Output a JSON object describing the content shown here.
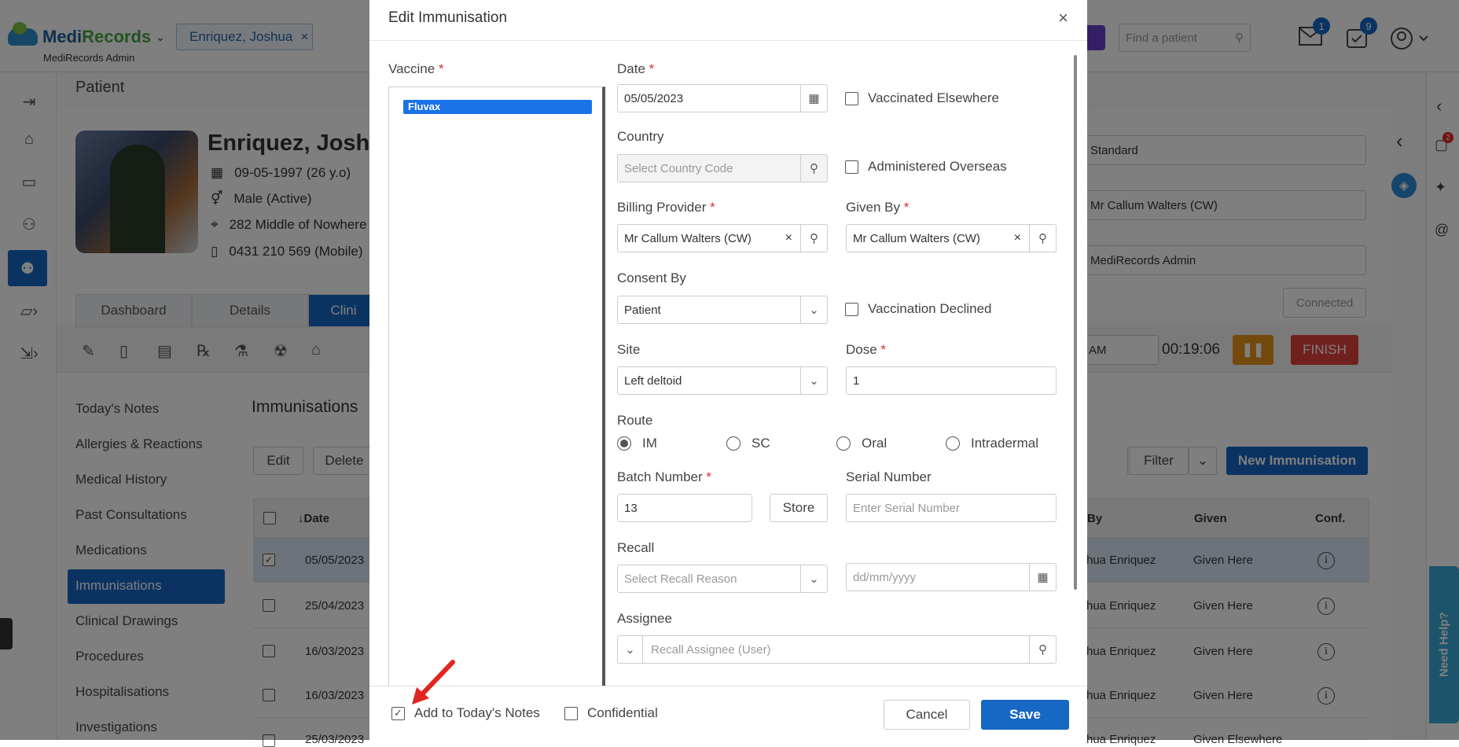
{
  "app": {
    "brand_main": "Medi",
    "brand_accent": "Records",
    "sub": "MediRecords Admin",
    "patient_chip": "Enriquez, Joshua",
    "find_placeholder": "Find a patient",
    "mail_count": "1",
    "tasks_count": "9"
  },
  "page": {
    "title": "Patient"
  },
  "patient": {
    "name": "Enriquez, Joshua",
    "dob": "09-05-1997 (26 y.o)",
    "gender": "Male (Active)",
    "address": "282 Middle of Nowhere",
    "phone": "0431 210 569 (Mobile)"
  },
  "tabs": [
    "Dashboard",
    "Details",
    "Clini"
  ],
  "right_panel": {
    "template": "Standard",
    "doctor": "Mr Callum Walters (CW)",
    "org": "MediRecords Admin",
    "connected": "Connected",
    "am": "AM",
    "timer": "00:19:06",
    "finish": "FINISH",
    "chat_badge": "2"
  },
  "clinical_nav": [
    "Today's Notes",
    "Allergies & Reactions",
    "Medical History",
    "Past Consultations",
    "Medications",
    "Immunisations",
    "Clinical Drawings",
    "Procedures",
    "Hospitalisations",
    "Investigations"
  ],
  "immunisations": {
    "title": "Immunisations",
    "edit": "Edit",
    "delete": "Delete",
    "filter": "Filter",
    "new": "New Immunisation",
    "columns": {
      "date": "↓Date",
      "by": "By",
      "given": "Given",
      "conf": "Conf."
    },
    "rows": [
      {
        "date": "05/05/2023",
        "by": "hua Enriquez",
        "given": "Given Here",
        "selected": true
      },
      {
        "date": "25/04/2023",
        "by": "hua Enriquez",
        "given": "Given Here",
        "selected": false
      },
      {
        "date": "16/03/2023",
        "by": "hua Enriquez",
        "given": "Given Here",
        "selected": false
      },
      {
        "date": "16/03/2023",
        "by": "hua Enriquez",
        "given": "Given Here",
        "selected": false
      },
      {
        "date": "25/03/2023",
        "by": "hua Enriquez",
        "given": "Given Elsewhere",
        "selected": false
      }
    ]
  },
  "modal": {
    "title": "Edit Immunisation",
    "vaccine_label": "Vaccine",
    "vaccine_selected": "Fluvax",
    "date_label": "Date",
    "date_value": "05/05/2023",
    "vaccinated_elsewhere": "Vaccinated Elsewhere",
    "country_label": "Country",
    "country_placeholder": "Select Country Code",
    "administered_overseas": "Administered Overseas",
    "billing_label": "Billing Provider",
    "billing_value": "Mr Callum Walters (CW)",
    "given_by_label": "Given By",
    "given_by_value": "Mr Callum Walters (CW)",
    "consent_label": "Consent By",
    "consent_value": "Patient",
    "vaccination_declined": "Vaccination Declined",
    "site_label": "Site",
    "site_value": "Left deltoid",
    "dose_label": "Dose",
    "dose_value": "1",
    "route_label": "Route",
    "routes": [
      "IM",
      "SC",
      "Oral",
      "Intradermal"
    ],
    "route_selected": "IM",
    "batch_label": "Batch Number",
    "batch_value": "13",
    "store": "Store",
    "serial_label": "Serial Number",
    "serial_placeholder": "Enter Serial Number",
    "recall_label": "Recall",
    "recall_placeholder": "Select Recall Reason",
    "recall_date_placeholder": "dd/mm/yyyy",
    "assignee_label": "Assignee",
    "assignee_placeholder": "Recall Assignee (User)",
    "add_today": "Add to Today's Notes",
    "add_today_checked": true,
    "confidential": "Confidential",
    "confidential_checked": false,
    "cancel": "Cancel",
    "save": "Save"
  },
  "need_help": "Need Help?",
  "colors": {
    "primary": "#1767c4",
    "danger": "#e0433b",
    "warning": "#e8931a",
    "annotation": "#e0261f"
  }
}
